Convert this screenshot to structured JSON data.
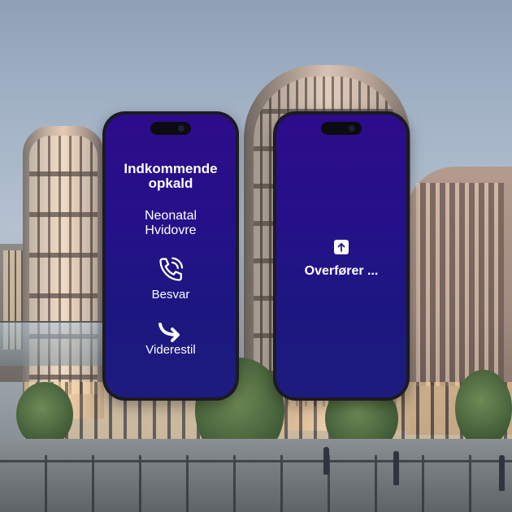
{
  "phones": {
    "incoming": {
      "title": "Indkommende opkald",
      "title_line1": "Indkommende",
      "title_line2": "opkald",
      "caller_line1": "Neonatal",
      "caller_line2": "Hvidovre",
      "answer_icon": "phone-ringing-icon",
      "answer_label": "Besvar",
      "forward_icon": "forward-arrow-icon",
      "forward_label": "Viderestil"
    },
    "transferring": {
      "status_icon": "transfer-up-icon",
      "status_label": "Overfører ..."
    }
  },
  "colors": {
    "screen_top": "#2d0c8a",
    "screen_bottom": "#1d1c7e",
    "text": "#ffffff"
  }
}
